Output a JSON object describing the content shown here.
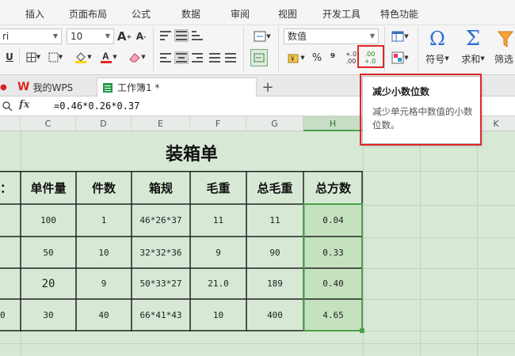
{
  "menu": {
    "tabs": [
      "插入",
      "页面布局",
      "公式",
      "数据",
      "审阅",
      "视图",
      "开发工具",
      "特色功能"
    ]
  },
  "ribbon": {
    "font_name": "ri",
    "font_size": "10",
    "number_format": "数值",
    "percent_label": "%",
    "comma_label": "⁹",
    "increase_decimal_top": "+.0",
    "increase_decimal_bottom": ".00",
    "decrease_decimal_top": ".00",
    "decrease_decimal_bottom": "+.0",
    "symbol_label": "符号",
    "sum_label": "求和",
    "filter_label": "筛选"
  },
  "doc_tabs": {
    "wps_label": "我的WPS",
    "book_label": "工作簿1 *",
    "new_tab": "+"
  },
  "formula_bar": {
    "fx_label": "fx",
    "formula": "=0.46*0.26*0.37"
  },
  "columns": [
    "C",
    "D",
    "E",
    "F",
    "G",
    "H",
    "K"
  ],
  "sheet": {
    "title": "装箱单",
    "headers": [
      "单件量",
      "件数",
      "箱规",
      "毛重",
      "总毛重",
      "总方数"
    ],
    "rows": [
      [
        "100",
        "1",
        "46*26*37",
        "11",
        "11",
        "0.04"
      ],
      [
        "50",
        "10",
        "32*32*36",
        "9",
        "90",
        "0.33"
      ],
      [
        "20",
        "9",
        "50*33*27",
        "21.0",
        "189",
        "0.40"
      ],
      [
        "30",
        "40",
        "66*41*43",
        "10",
        "400",
        "4.65"
      ]
    ],
    "left_edge_header": "：",
    "left_edge_last": "0"
  },
  "tooltip": {
    "title": "减少小数位数",
    "body": "减少单元格中数值的小数位数。"
  },
  "colors": {
    "accent_red": "#e0262a",
    "sheet_green": "#d7e9d5",
    "selection_green": "#c5e2bf",
    "selection_border": "#4aa14a"
  },
  "icons": [
    "underline-icon",
    "border-icon",
    "fill-color-icon",
    "font-color-icon",
    "eraser-icon",
    "increase-decimal-icon",
    "decrease-decimal-icon",
    "symbol-icon",
    "sum-icon",
    "filter-icon",
    "search-icon"
  ]
}
